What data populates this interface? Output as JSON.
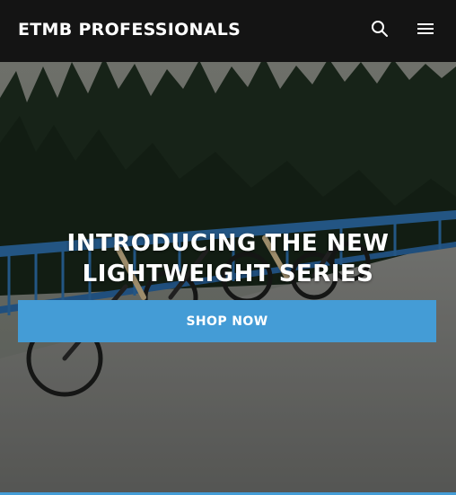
{
  "header": {
    "brand": "ETMB PROFESSIONALS",
    "search_icon": "search-icon",
    "menu_icon": "hamburger-menu-icon"
  },
  "hero": {
    "headline_line1": "INTRODUCING THE NEW",
    "headline_line2": "LIGHTWEIGHT SERIES",
    "cta_label": "SHOP NOW"
  },
  "colors": {
    "header_bg": "#141414",
    "accent": "#449cd6",
    "text": "#ffffff"
  }
}
